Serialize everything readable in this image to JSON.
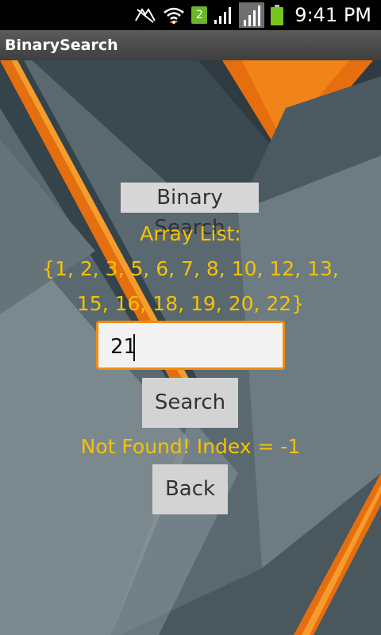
{
  "status_bar": {
    "time": "9:41 PM",
    "notification_badge": "2",
    "icons": [
      "signal-muted-icon",
      "wifi-icon",
      "notification-badge-icon",
      "cell-signal-icon",
      "cell-signal-icon",
      "battery-icon"
    ]
  },
  "app": {
    "title": "BinarySearch"
  },
  "main": {
    "heading": "Binary Search",
    "array_label": "Array List:",
    "array_line1": "{1, 2, 3, 5, 6, 7, 8, 10, 12, 13,",
    "array_line2": "15, 16, 18, 19, 20, 22}",
    "search_input_value": "21",
    "search_button_label": "Search",
    "result_text": "Not Found! Index = -1",
    "back_button_label": "Back"
  },
  "colors": {
    "accent_orange": "#f28c11",
    "text_yellow": "#f6c200",
    "button_gray": "#d3d3d3",
    "background_slate": "#4d5b63"
  }
}
